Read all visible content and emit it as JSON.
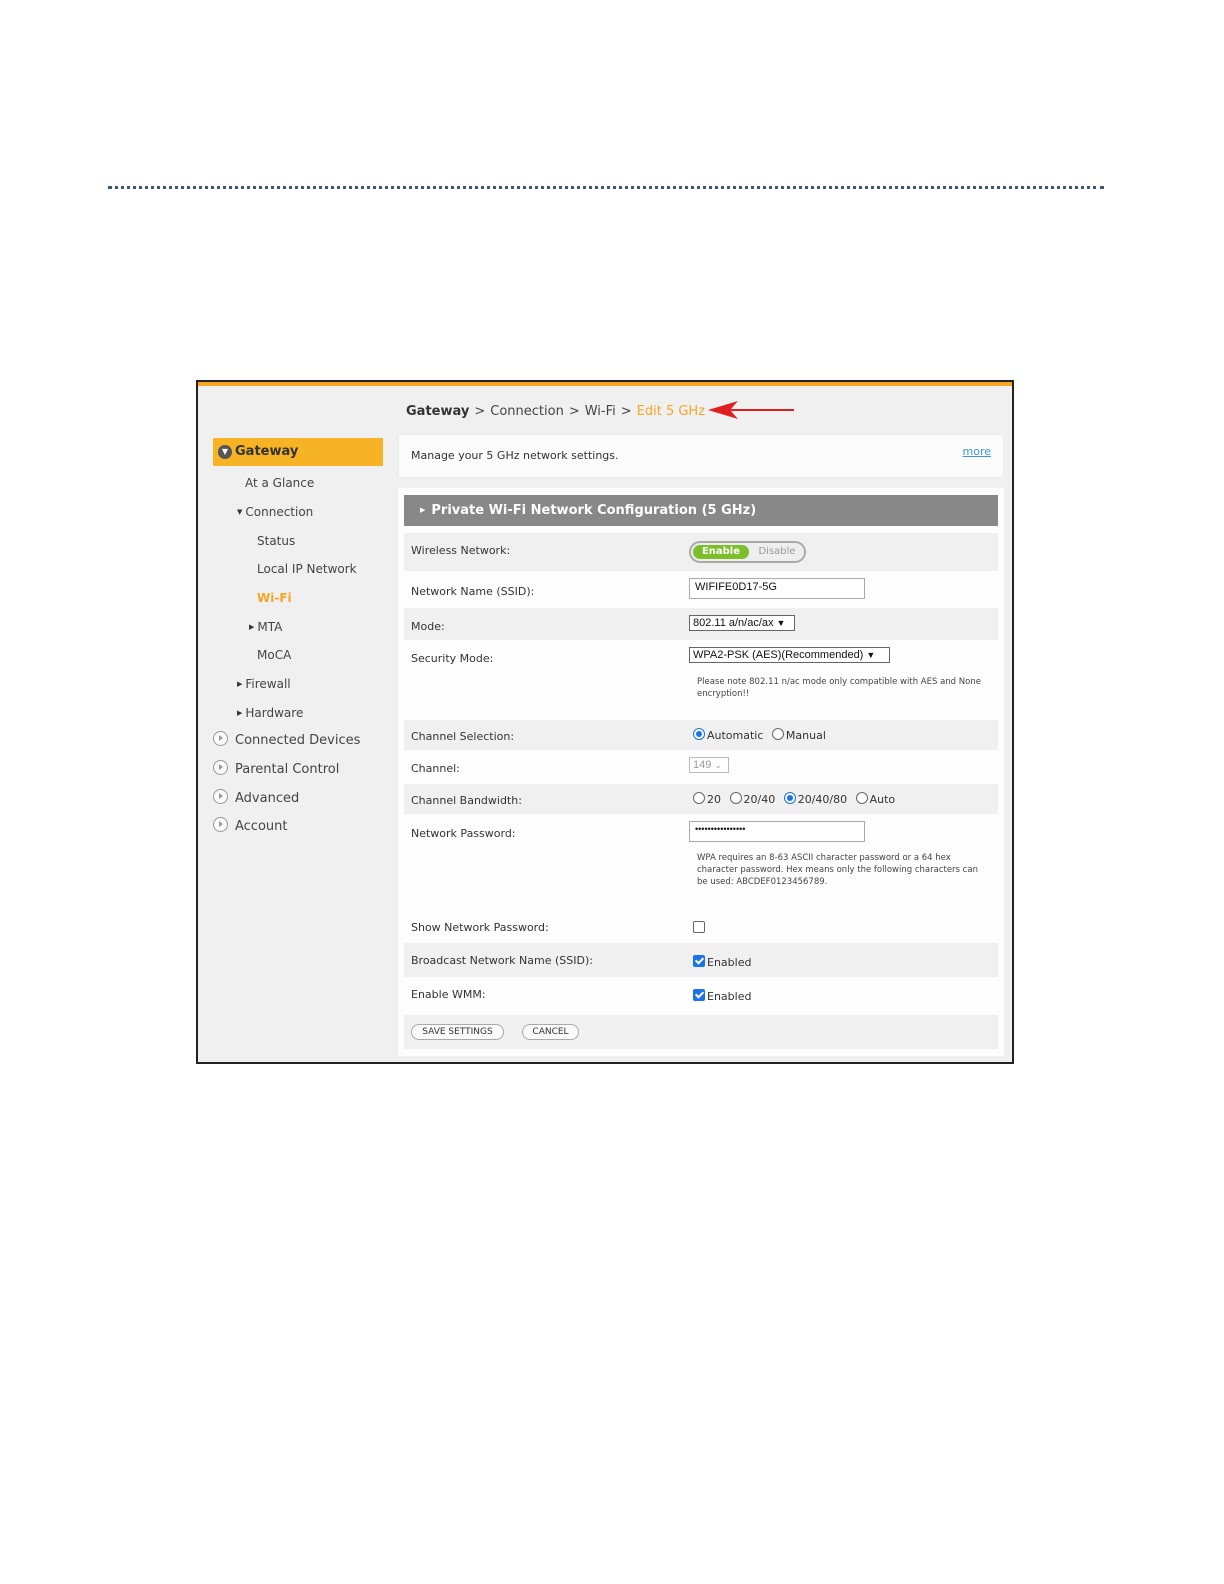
{
  "breadcrumb": {
    "root": "Gateway",
    "separator": ">",
    "level1": "Connection",
    "level2": "Wi-Fi",
    "current": "Edit 5 GHz"
  },
  "sidebar": {
    "head": "Gateway",
    "items": [
      {
        "label": "At a Glance",
        "state": "default"
      },
      {
        "label": "Connection",
        "state": "expanded"
      },
      {
        "label": "Status",
        "state": "default"
      },
      {
        "label": "Local IP Network",
        "state": "default"
      },
      {
        "label": "Wi-Fi",
        "state": "active"
      },
      {
        "label": "MTA",
        "state": "collapsed"
      },
      {
        "label": "MoCA",
        "state": "default"
      },
      {
        "label": "Firewall",
        "state": "collapsed"
      },
      {
        "label": "Hardware",
        "state": "collapsed"
      }
    ],
    "top_items": [
      {
        "label": "Connected Devices"
      },
      {
        "label": "Parental Control"
      },
      {
        "label": "Advanced"
      },
      {
        "label": "Account"
      }
    ]
  },
  "intro": {
    "text": "Manage your 5 GHz network settings.",
    "more": "more"
  },
  "panel": {
    "title": "Private Wi-Fi Network Configuration (5 GHz)",
    "wireless": {
      "label": "Wireless Network:",
      "enable": "Enable",
      "disable": "Disable",
      "selected": "Enable"
    },
    "ssid": {
      "label": "Network Name (SSID):",
      "value": "WIFIFE0D17-5G"
    },
    "mode": {
      "label": "Mode:",
      "value": "802.11 a/n/ac/ax"
    },
    "security": {
      "label": "Security Mode:",
      "value": "WPA2-PSK (AES)(Recommended)",
      "note": "Please note 802.11 n/ac mode only compatible with AES and None encryption!!"
    },
    "channel_selection": {
      "label": "Channel Selection:",
      "options": [
        "Automatic",
        "Manual"
      ],
      "selected": "Automatic"
    },
    "channel": {
      "label": "Channel:",
      "value": "149"
    },
    "bandwidth": {
      "label": "Channel Bandwidth:",
      "options": [
        "20",
        "20/40",
        "20/40/80",
        "Auto"
      ],
      "selected": "20/40/80"
    },
    "password": {
      "label": "Network Password:",
      "value": "••••••••••••••••",
      "note": "WPA requires an 8-63 ASCII character password or a 64 hex character password. Hex means only the following characters can be used: ABCDEF0123456789."
    },
    "show_password": {
      "label": "Show Network Password:",
      "checked": false
    },
    "broadcast": {
      "label": "Broadcast Network Name (SSID):",
      "checked": true,
      "text": "Enabled"
    },
    "wmm": {
      "label": "Enable WMM:",
      "checked": true,
      "text": "Enabled"
    },
    "save": "SAVE SETTINGS",
    "cancel": "CANCEL"
  },
  "colors": {
    "accent": "#f5a623",
    "toggle_on": "#7bbf2a",
    "panel_header": "#888888",
    "link": "#3a9ad9",
    "arrow": "#e02020"
  }
}
